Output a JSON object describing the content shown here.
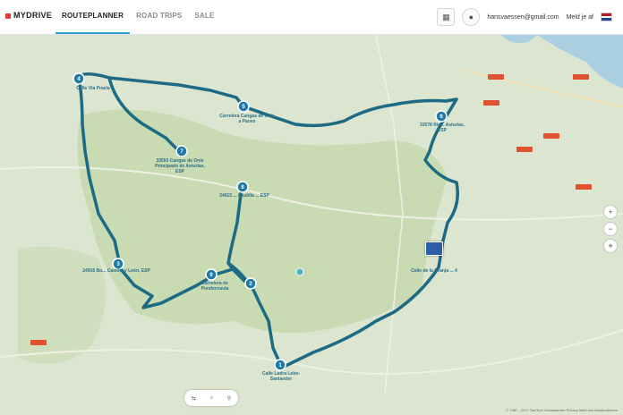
{
  "app": {
    "brand": "MYDRIVE"
  },
  "nav": {
    "items": [
      {
        "label": "ROUTEPLANNER",
        "active": true
      },
      {
        "label": "ROAD TRIPS",
        "active": false
      },
      {
        "label": "SALE",
        "active": false
      }
    ]
  },
  "header": {
    "email": "hansvaessen@gmail.com",
    "signin": "Meld je af",
    "language": "NL"
  },
  "waypoints": [
    {
      "n": "1",
      "label": "Calle Ladra Lebo- Santander"
    },
    {
      "n": "2",
      "label": ""
    },
    {
      "n": "3",
      "label": "24916 Bo... Castilla y León, ESP"
    },
    {
      "n": "4",
      "label": "Calle Vía Praela"
    },
    {
      "n": "5",
      "label": "Carretera Cangas de Onís a Panes"
    },
    {
      "n": "6",
      "label": "33578 Rio... Asturias, ESP"
    },
    {
      "n": "7",
      "label": "33550 Cangas de Onís Principado de Asturias, ESP"
    },
    {
      "n": "8",
      "label": "24915 ... Castilla ... ESP"
    },
    {
      "n": "9",
      "label": "Carretera de Ponderrueda"
    }
  ],
  "endpoint": {
    "label": "Calle de la Granja ... 4"
  },
  "map_controls": {
    "zoom_in": "+",
    "zoom_out": "−",
    "recenter": "⌖"
  },
  "bottom_toolbar": {
    "items": [
      "⇆",
      "⌂",
      "⚲"
    ]
  },
  "credits": "© 1987 - 2017 TomTom   Voorwaarden   Privacy   Meld een kaartprobleem",
  "colors": {
    "route": "#1d6a84",
    "accent": "#2e9fd0",
    "shield": "#e0522f",
    "park": "#c9dbb3",
    "water": "#a9cfe0"
  }
}
